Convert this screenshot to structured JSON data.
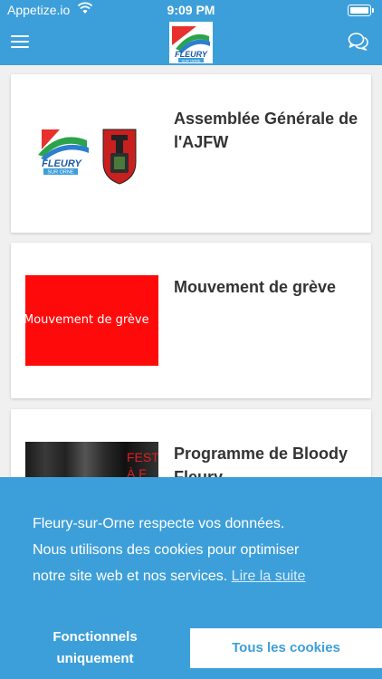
{
  "status_bar": {
    "carrier": "Appetize.io",
    "time": "9:09 PM"
  },
  "navbar": {
    "logo_text": "FLEURY",
    "logo_subtext": "SUR ORNE"
  },
  "cards": [
    {
      "title": "Assemblée Générale de l'AJFW",
      "logo_text": "FLEURY",
      "logo_subtext": "SUR ORNE"
    },
    {
      "title": "Mouvement de grève",
      "thumb_text": "Mouvement de grève"
    },
    {
      "title": "Programme de Bloody Fleury",
      "thumb_text": "FEST\nÀ F"
    }
  ],
  "cookie_banner": {
    "line1": "Fleury-sur-Orne respecte vos données.",
    "line2": "Nous utilisons des cookies pour optimiser",
    "line3": "notre site web et nos services.",
    "link": "Lire la suite",
    "btn_functional": "Fonctionnels uniquement",
    "btn_all": "Tous les cookies"
  },
  "colors": {
    "primary": "#3d9fd9",
    "thumb_red": "#ff0a0a"
  }
}
